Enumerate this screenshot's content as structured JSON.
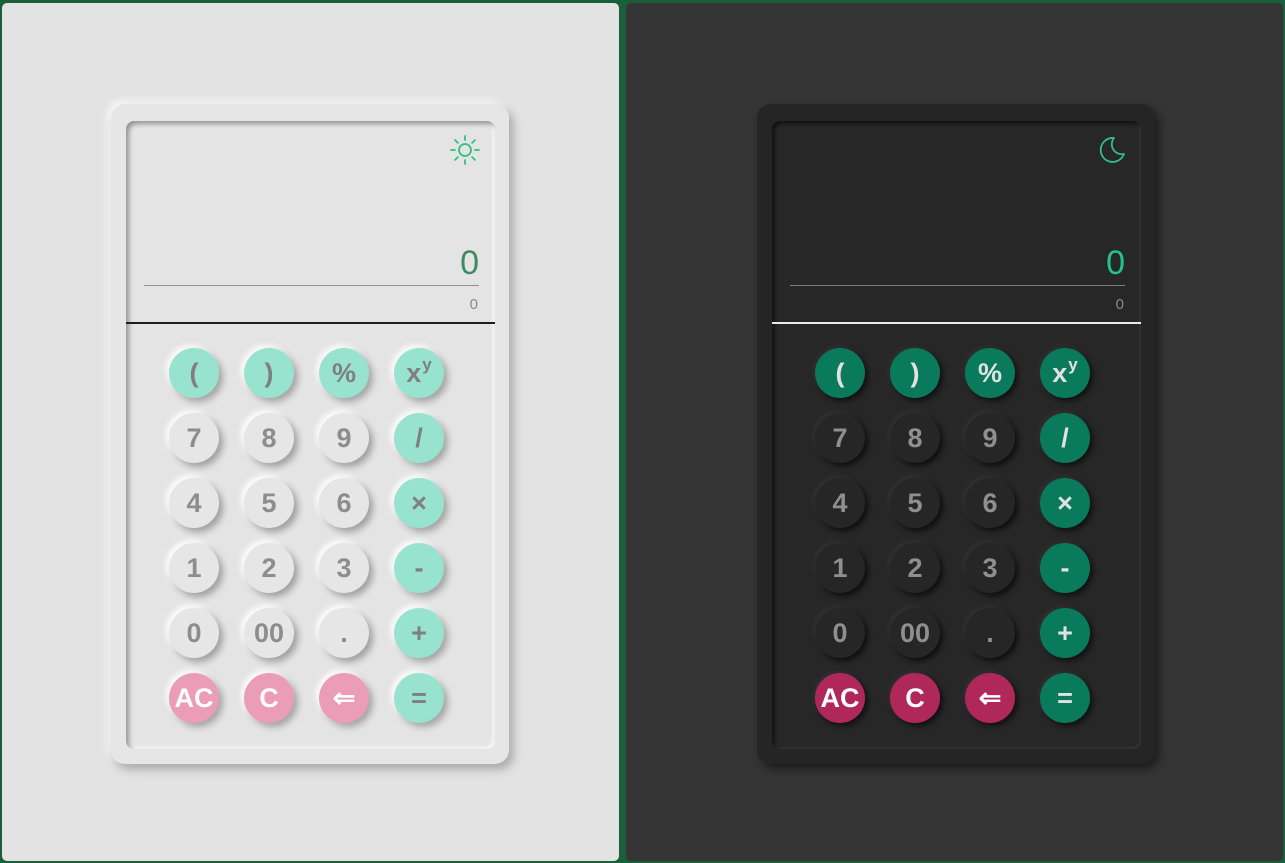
{
  "colors": {
    "light_accent": "#3d8a63",
    "light_operator": "#98e3cf",
    "light_clear": "#eb9db7",
    "dark_accent": "#22c48a",
    "dark_operator": "#0a7a5c",
    "dark_clear": "#b0285a"
  },
  "light": {
    "theme_icon": "sun-icon",
    "display": {
      "result": "0",
      "expression": "0"
    }
  },
  "dark": {
    "theme_icon": "moon-icon",
    "display": {
      "result": "0",
      "expression": "0"
    }
  },
  "keys": [
    {
      "label": "(",
      "kind": "op",
      "name": "open-paren-key"
    },
    {
      "label": ")",
      "kind": "op",
      "name": "close-paren-key"
    },
    {
      "label": "%",
      "kind": "op",
      "name": "percent-key"
    },
    {
      "label": "x",
      "sup": "y",
      "kind": "op",
      "name": "power-key"
    },
    {
      "label": "7",
      "kind": "num",
      "name": "digit-7-key"
    },
    {
      "label": "8",
      "kind": "num",
      "name": "digit-8-key"
    },
    {
      "label": "9",
      "kind": "num",
      "name": "digit-9-key"
    },
    {
      "label": "/",
      "kind": "op",
      "name": "divide-key"
    },
    {
      "label": "4",
      "kind": "num",
      "name": "digit-4-key"
    },
    {
      "label": "5",
      "kind": "num",
      "name": "digit-5-key"
    },
    {
      "label": "6",
      "kind": "num",
      "name": "digit-6-key"
    },
    {
      "label": "×",
      "kind": "op",
      "name": "multiply-key"
    },
    {
      "label": "1",
      "kind": "num",
      "name": "digit-1-key"
    },
    {
      "label": "2",
      "kind": "num",
      "name": "digit-2-key"
    },
    {
      "label": "3",
      "kind": "num",
      "name": "digit-3-key"
    },
    {
      "label": "-",
      "kind": "op",
      "name": "subtract-key"
    },
    {
      "label": "0",
      "kind": "num",
      "name": "digit-0-key"
    },
    {
      "label": "00",
      "kind": "num",
      "name": "double-zero-key"
    },
    {
      "label": ".",
      "kind": "num",
      "name": "decimal-key"
    },
    {
      "label": "+",
      "kind": "op",
      "name": "add-key"
    },
    {
      "label": "AC",
      "kind": "clr",
      "name": "all-clear-key"
    },
    {
      "label": "C",
      "kind": "clr",
      "name": "clear-key"
    },
    {
      "label": "⇐",
      "kind": "clr",
      "name": "backspace-key"
    },
    {
      "label": "=",
      "kind": "op",
      "name": "equals-key"
    }
  ]
}
